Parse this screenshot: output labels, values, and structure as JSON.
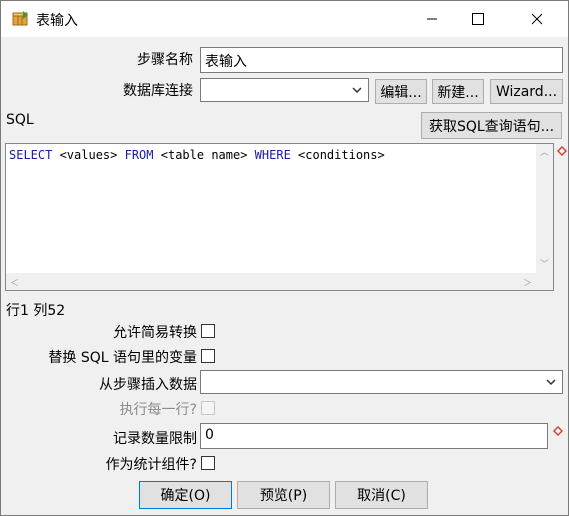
{
  "window": {
    "title": "表输入",
    "icon": "table-input-icon"
  },
  "form": {
    "step_name_label": "步骤名称",
    "step_name_value": "表输入",
    "db_connection_label": "数据库连接",
    "db_connection_value": "",
    "edit_button": "编辑...",
    "new_button": "新建...",
    "wizard_button": "Wizard...",
    "sql_label": "SQL",
    "get_sql_button": "获取SQL查询语句..."
  },
  "sql": {
    "keywords": [
      "SELECT",
      "FROM",
      "WHERE"
    ],
    "kw_select": "SELECT",
    "p_values": " <values> ",
    "kw_from": "FROM",
    "p_table": " <table name> ",
    "kw_where": "WHERE",
    "p_conditions": " <conditions>"
  },
  "status": {
    "position": "行1 列52"
  },
  "options": {
    "lazy_conversion_label": "允许简易转换",
    "lazy_conversion_checked": false,
    "replace_vars_label": "替换 SQL 语句里的变量",
    "replace_vars_checked": false,
    "insert_from_step_label": "从步骤插入数据",
    "insert_from_step_value": "",
    "execute_each_row_label": "执行每一行?",
    "execute_each_row_checked": false,
    "limit_label": "记录数量限制",
    "limit_value": "0",
    "stats_label": "作为统计组件?",
    "stats_checked": false
  },
  "buttons": {
    "ok": "确定(O)",
    "preview": "预览(P)",
    "cancel": "取消(C)"
  },
  "colors": {
    "keyword": "#1a1aa6",
    "default_border": "#0078d7",
    "warning": "#d93a2b"
  }
}
